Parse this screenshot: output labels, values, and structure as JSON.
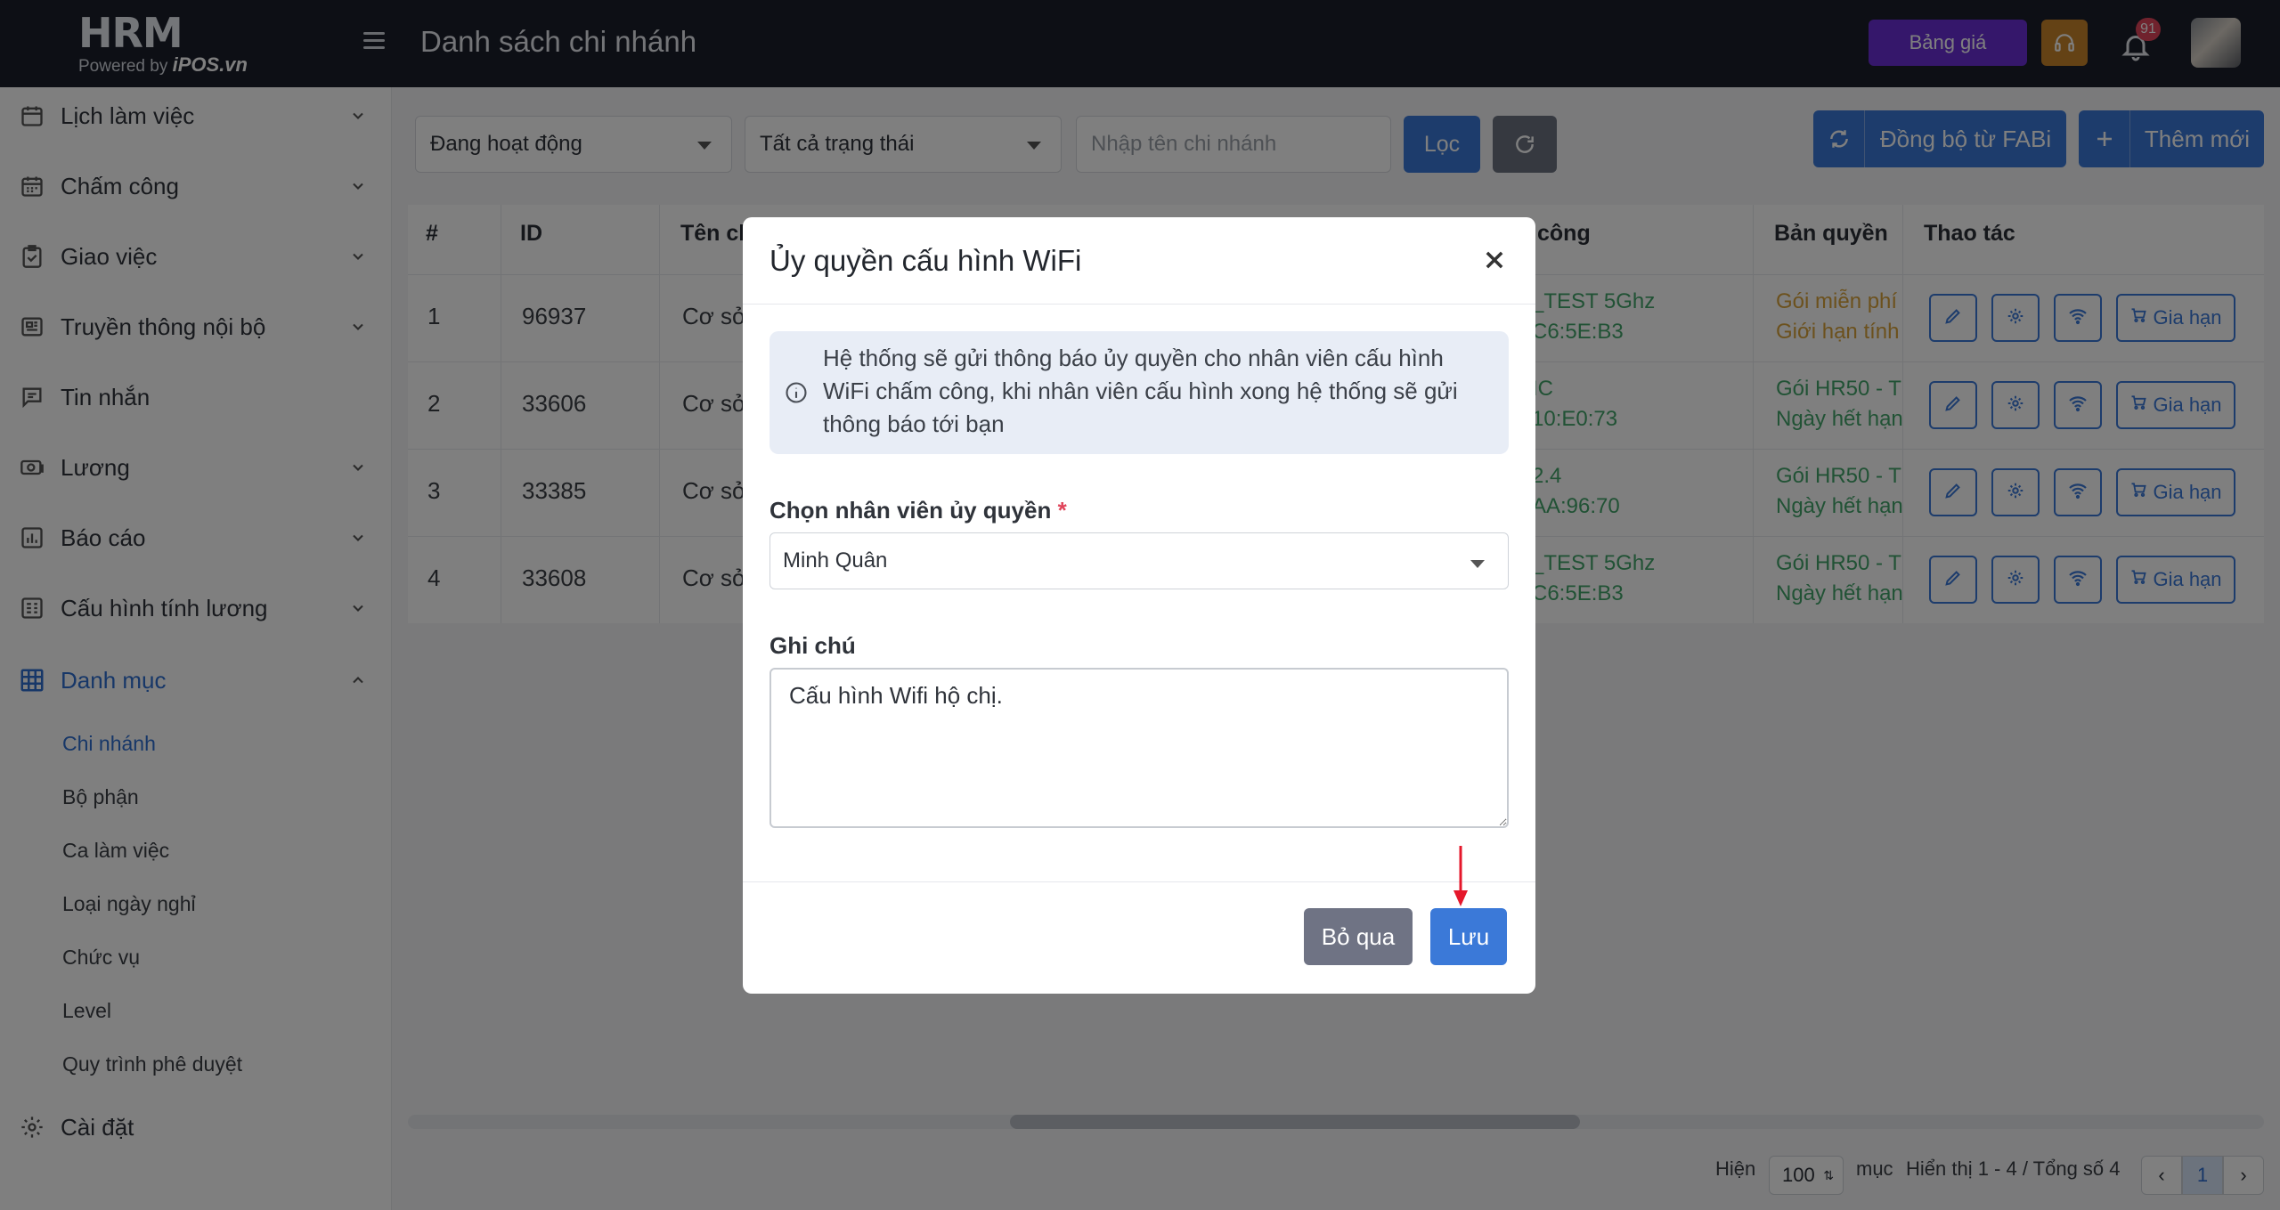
{
  "topbar": {
    "logo_main": "HRM",
    "logo_powered": "Powered by",
    "logo_brand": "iPOS.vn",
    "page_title": "Danh sách chi nhánh",
    "price_button": "Bảng giá",
    "notification_count": "91"
  },
  "sidebar": {
    "items": [
      {
        "label": "Lịch làm việc",
        "icon": "calendar-icon"
      },
      {
        "label": "Chấm công",
        "icon": "calendar-grid-icon"
      },
      {
        "label": "Giao việc",
        "icon": "clipboard-check-icon"
      },
      {
        "label": "Truyền thông nội bộ",
        "icon": "newspaper-icon"
      },
      {
        "label": "Tin nhắn",
        "icon": "message-icon"
      },
      {
        "label": "Lương",
        "icon": "money-icon"
      },
      {
        "label": "Báo cáo",
        "icon": "chart-icon"
      },
      {
        "label": "Cấu hình tính lương",
        "icon": "config-icon"
      },
      {
        "label": "Danh mục",
        "icon": "grid-icon"
      }
    ],
    "subitems": [
      "Chi nhánh",
      "Bộ phận",
      "Ca làm việc",
      "Loại ngày nghỉ",
      "Chức vụ",
      "Level",
      "Quy trình phê duyệt"
    ],
    "settings_label": "Cài đặt"
  },
  "filters": {
    "status_active": "Đang hoạt động",
    "status_all": "Tất cả trạng thái",
    "search_placeholder": "Nhập tên chi nhánh",
    "filter_button": "Lọc",
    "sync_button": "Đồng bộ từ FABi",
    "add_button": "Thêm mới"
  },
  "table": {
    "headers": {
      "index": "#",
      "id": "ID",
      "name": "Tên ch",
      "wifi": "công",
      "license": "Bản quyền",
      "actions": "Thao tác"
    },
    "renew_label": "Gia hạn",
    "rows": [
      {
        "index": "1",
        "id": "96937",
        "name": "Cơ sở",
        "wifi1": "_TEST 5Ghz",
        "wifi2": "C6:5E:B3",
        "lic1": "Gói miễn phí",
        "lic2": "Giới hạn tính",
        "lic_color": "#d8a23a"
      },
      {
        "index": "2",
        "id": "33606",
        "name": "Cơ sở",
        "wifi1": "IC",
        "wifi2": "10:E0:73",
        "lic1": "Gói HR50 - T",
        "lic2": "Ngày hết hạn",
        "lic_color": "#43a56a"
      },
      {
        "index": "3",
        "id": "33385",
        "name": "Cơ sở",
        "wifi1": "2.4",
        "wifi2": "AA:96:70",
        "lic1": "Gói HR50 - T",
        "lic2": "Ngày hết hạn",
        "lic_color": "#43a56a"
      },
      {
        "index": "4",
        "id": "33608",
        "name": "Cơ sở",
        "wifi1": "_TEST 5Ghz",
        "wifi2": "C6:5E:B3",
        "lic1": "Gói HR50 - T",
        "lic2": "Ngày hết hạn",
        "lic_color": "#43a56a"
      }
    ]
  },
  "pagination": {
    "show_label": "Hiện",
    "page_size": "100",
    "unit_label": "mục",
    "summary": "Hiển thị 1 - 4 / Tổng số 4",
    "prev": "‹",
    "current": "1",
    "next": "›"
  },
  "modal": {
    "title": "Ủy quyền cấu hình WiFi",
    "info": "Hệ thống sẽ gửi thông báo ủy quyền cho nhân viên cấu hình WiFi chấm công, khi nhân viên cấu hình xong hệ thống sẽ gửi thông báo tới bạn",
    "employee_label": "Chọn nhân viên ủy quyền",
    "required_mark": "*",
    "employee_value": "Minh Quân",
    "note_label": "Ghi chú",
    "note_value": "Cấu hình Wifi hộ chị.",
    "cancel_button": "Bỏ qua",
    "save_button": "Lưu"
  },
  "colors": {
    "primary": "#3b79d8",
    "topbar": "#1b1f2b",
    "price": "#6b2fd6",
    "support": "#c8842a",
    "arrow": "#e5172b"
  }
}
